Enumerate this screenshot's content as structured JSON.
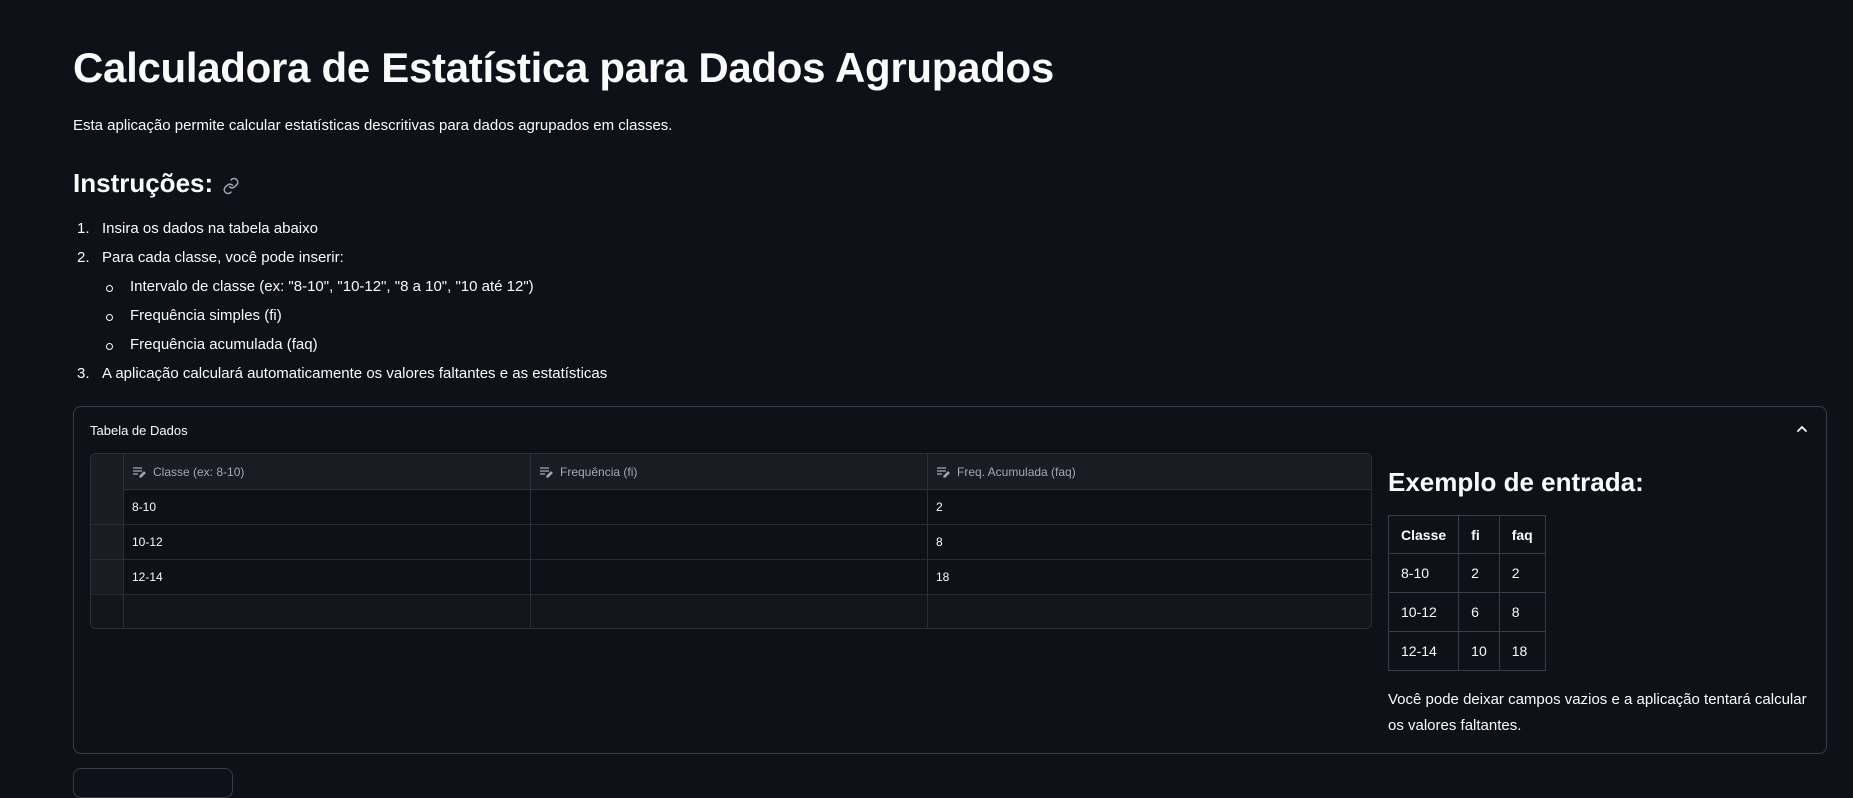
{
  "header": {
    "title": "Calculadora de Estatística para Dados Agrupados",
    "subtitle": "Esta aplicação permite calcular estatísticas descritivas para dados agrupados em classes."
  },
  "instructions": {
    "heading": "Instruções:",
    "steps": [
      {
        "num": "1.",
        "text": "Insira os dados na tabela abaixo"
      },
      {
        "num": "2.",
        "text": "Para cada classe, você pode inserir:"
      },
      {
        "num": "3.",
        "text": "A aplicação calculará automaticamente os valores faltantes e as estatísticas"
      }
    ],
    "sub_items": [
      "Intervalo de classe (ex: \"8-10\", \"10-12\", \"8 a 10\", \"10 até 12\")",
      "Frequência simples (fi)",
      "Frequência acumulada (faq)"
    ]
  },
  "expander": {
    "label": "Tabela de Dados",
    "editor": {
      "columns": [
        "Classe (ex: 8-10)",
        "Frequência (fi)",
        "Freq. Acumulada (faq)"
      ],
      "rows": [
        [
          "8-10",
          "",
          "2"
        ],
        [
          "10-12",
          "",
          "8"
        ],
        [
          "12-14",
          "",
          "18"
        ],
        [
          "",
          "",
          ""
        ]
      ]
    },
    "example": {
      "title": "Exemplo de entrada:",
      "headers": [
        "Classe",
        "fi",
        "faq"
      ],
      "rows": [
        [
          "8-10",
          "2",
          "2"
        ],
        [
          "10-12",
          "6",
          "8"
        ],
        [
          "12-14",
          "10",
          "18"
        ]
      ],
      "note": "Você pode deixar campos vazios e a aplicação tentará calcular os valores faltantes."
    }
  }
}
